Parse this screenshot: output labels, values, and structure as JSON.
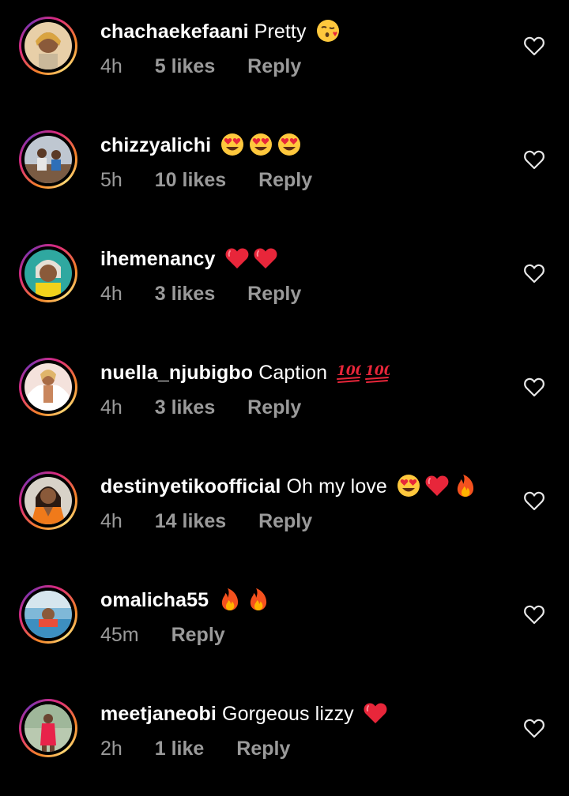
{
  "colors": {
    "background": "#000000",
    "text": "#ffffff",
    "meta": "#9a9a9a",
    "story_ring_start": "#f58529",
    "story_ring_end": "#dd2a7b"
  },
  "comments": [
    {
      "username": "chachaekefaani",
      "text": "Pretty",
      "emojis": [
        "kissing-face-emoji"
      ],
      "time": "4h",
      "likes": "5 likes",
      "reply": "Reply"
    },
    {
      "username": "chizzyalichi",
      "text": "",
      "emojis": [
        "heart-eyes-emoji",
        "heart-eyes-emoji",
        "heart-eyes-emoji"
      ],
      "time": "5h",
      "likes": "10 likes",
      "reply": "Reply"
    },
    {
      "username": "ihemenancy",
      "text": "",
      "emojis": [
        "red-heart-emoji",
        "red-heart-emoji"
      ],
      "time": "4h",
      "likes": "3 likes",
      "reply": "Reply"
    },
    {
      "username": "nuella_njubigbo",
      "text": "Caption",
      "emojis": [
        "hundred-points-emoji",
        "hundred-points-emoji"
      ],
      "time": "4h",
      "likes": "3 likes",
      "reply": "Reply"
    },
    {
      "username": "destinyetikoofficial",
      "text": "Oh my love",
      "emojis": [
        "heart-eyes-emoji",
        "red-heart-emoji",
        "fire-emoji"
      ],
      "time": "4h",
      "likes": "14 likes",
      "reply": "Reply"
    },
    {
      "username": "omalicha55",
      "text": "",
      "emojis": [
        "fire-emoji",
        "fire-emoji"
      ],
      "time": "45m",
      "likes": "",
      "reply": "Reply"
    },
    {
      "username": "meetjaneobi",
      "text": "Gorgeous lizzy",
      "emojis": [
        "red-heart-emoji"
      ],
      "time": "2h",
      "likes": "1 like",
      "reply": "Reply"
    }
  ]
}
